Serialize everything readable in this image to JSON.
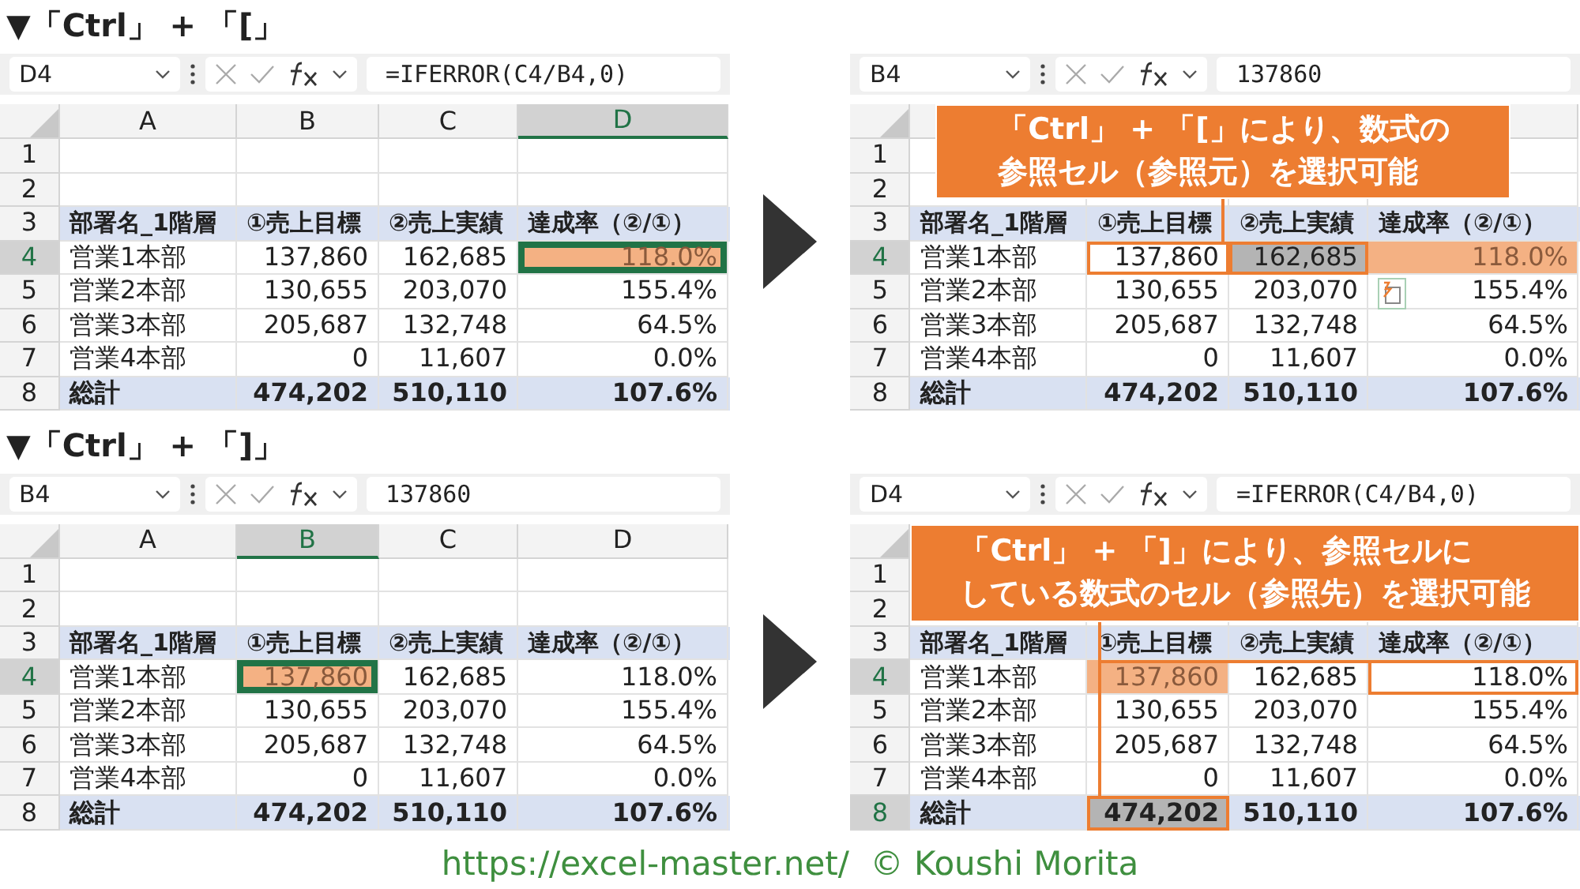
{
  "sheets": [
    {
      "title": "▼「Ctrl」 + 「[」",
      "name_box": "D4",
      "formula": "=IFERROR(C4/B4,0)",
      "column_headers": [
        {
          "label": "A",
          "selected": false
        },
        {
          "label": "B",
          "selected": false
        },
        {
          "label": "C",
          "selected": false
        },
        {
          "label": "D",
          "selected": true
        }
      ],
      "rows": [
        {
          "number": "1",
          "kind": "blank",
          "selected": false
        },
        {
          "number": "2",
          "kind": "blank",
          "selected": false
        },
        {
          "number": "3",
          "kind": "header",
          "selected": false,
          "cells": [
            {
              "text": "部署名_1階層",
              "highlighted": false,
              "shaded": false,
              "outlined": false,
              "active": false
            },
            {
              "text": "①売上目標",
              "highlighted": false,
              "shaded": false,
              "outlined": false,
              "active": false
            },
            {
              "text": "②売上実績",
              "highlighted": false,
              "shaded": false,
              "outlined": false,
              "active": false
            },
            {
              "text": "達成率（②/①）",
              "highlighted": false,
              "shaded": false,
              "outlined": false,
              "active": false
            }
          ]
        },
        {
          "number": "4",
          "kind": "data",
          "selected": true,
          "cells": [
            {
              "text": "営業1本部",
              "highlighted": false,
              "shaded": false,
              "outlined": false,
              "active": false
            },
            {
              "text": "137,860",
              "highlighted": false,
              "shaded": false,
              "outlined": false,
              "active": false
            },
            {
              "text": "162,685",
              "highlighted": false,
              "shaded": false,
              "outlined": false,
              "active": false
            },
            {
              "text": "118.0%",
              "highlighted": true,
              "shaded": false,
              "outlined": false,
              "active": true
            }
          ]
        },
        {
          "number": "5",
          "kind": "data",
          "selected": false,
          "cells": [
            {
              "text": "営業2本部",
              "highlighted": false,
              "shaded": false,
              "outlined": false,
              "active": false
            },
            {
              "text": "130,655",
              "highlighted": false,
              "shaded": false,
              "outlined": false,
              "active": false
            },
            {
              "text": "203,070",
              "highlighted": false,
              "shaded": false,
              "outlined": false,
              "active": false
            },
            {
              "text": "155.4%",
              "highlighted": false,
              "shaded": false,
              "outlined": false,
              "active": false
            }
          ]
        },
        {
          "number": "6",
          "kind": "data",
          "selected": false,
          "cells": [
            {
              "text": "営業3本部",
              "highlighted": false,
              "shaded": false,
              "outlined": false,
              "active": false
            },
            {
              "text": "205,687",
              "highlighted": false,
              "shaded": false,
              "outlined": false,
              "active": false
            },
            {
              "text": "132,748",
              "highlighted": false,
              "shaded": false,
              "outlined": false,
              "active": false
            },
            {
              "text": "64.5%",
              "highlighted": false,
              "shaded": false,
              "outlined": false,
              "active": false
            }
          ]
        },
        {
          "number": "7",
          "kind": "data",
          "selected": false,
          "cells": [
            {
              "text": "営業4本部",
              "highlighted": false,
              "shaded": false,
              "outlined": false,
              "active": false
            },
            {
              "text": "0",
              "highlighted": false,
              "shaded": false,
              "outlined": false,
              "active": false
            },
            {
              "text": "11,607",
              "highlighted": false,
              "shaded": false,
              "outlined": false,
              "active": false
            },
            {
              "text": "0.0%",
              "highlighted": false,
              "shaded": false,
              "outlined": false,
              "active": false
            }
          ]
        },
        {
          "number": "8",
          "kind": "total",
          "selected": false,
          "cells": [
            {
              "text": "総計",
              "highlighted": false,
              "shaded": false,
              "outlined": false,
              "active": false
            },
            {
              "text": "474,202",
              "highlighted": false,
              "shaded": false,
              "outlined": false,
              "active": false
            },
            {
              "text": "510,110",
              "highlighted": false,
              "shaded": false,
              "outlined": false,
              "active": false
            },
            {
              "text": "107.6%",
              "highlighted": false,
              "shaded": false,
              "outlined": false,
              "active": false
            }
          ]
        }
      ]
    },
    {
      "name_box": "B4",
      "formula": "137860",
      "callout": {
        "kind": "precedents",
        "lines": [
          "「Ctrl」 + 「[」により、数式の",
          "参照セル（参照元）を選択可能"
        ]
      },
      "rows": [
        {
          "number": "1",
          "kind": "blank",
          "selected": false
        },
        {
          "number": "2",
          "kind": "blank",
          "selected": false
        },
        {
          "number": "3",
          "kind": "header",
          "selected": false,
          "cells": [
            {
              "text": "部署名_1階層",
              "highlighted": false,
              "shaded": false,
              "outlined": false,
              "active": false
            },
            {
              "text": "①売上目標",
              "highlighted": false,
              "shaded": false,
              "outlined": false,
              "active": false
            },
            {
              "text": "②売上実績",
              "highlighted": false,
              "shaded": false,
              "outlined": false,
              "active": false
            },
            {
              "text": "達成率（②/①）",
              "highlighted": false,
              "shaded": false,
              "outlined": false,
              "active": false
            }
          ]
        },
        {
          "number": "4",
          "kind": "data",
          "selected": true,
          "cells": [
            {
              "text": "営業1本部",
              "highlighted": false,
              "shaded": false,
              "outlined": false,
              "active": false
            },
            {
              "text": "137,860",
              "highlighted": false,
              "shaded": false,
              "outlined": true,
              "active": false
            },
            {
              "text": "162,685",
              "highlighted": false,
              "shaded": true,
              "outlined": true,
              "active": false
            },
            {
              "text": "118.0%",
              "highlighted": true,
              "shaded": false,
              "outlined": false,
              "active": false
            }
          ]
        },
        {
          "number": "5",
          "kind": "data",
          "selected": false,
          "cells": [
            {
              "text": "営業2本部",
              "highlighted": false,
              "shaded": false,
              "outlined": false,
              "active": false
            },
            {
              "text": "130,655",
              "highlighted": false,
              "shaded": false,
              "outlined": false,
              "active": false
            },
            {
              "text": "203,070",
              "highlighted": false,
              "shaded": false,
              "outlined": false,
              "active": false
            },
            {
              "text": "155.4%",
              "highlighted": false,
              "shaded": false,
              "outlined": false,
              "active": false,
              "smart_tag": true
            }
          ]
        },
        {
          "number": "6",
          "kind": "data",
          "selected": false,
          "cells": [
            {
              "text": "営業3本部",
              "highlighted": false,
              "shaded": false,
              "outlined": false,
              "active": false
            },
            {
              "text": "205,687",
              "highlighted": false,
              "shaded": false,
              "outlined": false,
              "active": false
            },
            {
              "text": "132,748",
              "highlighted": false,
              "shaded": false,
              "outlined": false,
              "active": false
            },
            {
              "text": "64.5%",
              "highlighted": false,
              "shaded": false,
              "outlined": false,
              "active": false
            }
          ]
        },
        {
          "number": "7",
          "kind": "data",
          "selected": false,
          "cells": [
            {
              "text": "営業4本部",
              "highlighted": false,
              "shaded": false,
              "outlined": false,
              "active": false
            },
            {
              "text": "0",
              "highlighted": false,
              "shaded": false,
              "outlined": false,
              "active": false
            },
            {
              "text": "11,607",
              "highlighted": false,
              "shaded": false,
              "outlined": false,
              "active": false
            },
            {
              "text": "0.0%",
              "highlighted": false,
              "shaded": false,
              "outlined": false,
              "active": false
            }
          ]
        },
        {
          "number": "8",
          "kind": "total",
          "selected": false,
          "cells": [
            {
              "text": "総計",
              "highlighted": false,
              "shaded": false,
              "outlined": false,
              "active": false
            },
            {
              "text": "474,202",
              "highlighted": false,
              "shaded": false,
              "outlined": false,
              "active": false
            },
            {
              "text": "510,110",
              "highlighted": false,
              "shaded": false,
              "outlined": false,
              "active": false
            },
            {
              "text": "107.6%",
              "highlighted": false,
              "shaded": false,
              "outlined": false,
              "active": false
            }
          ]
        }
      ]
    },
    {
      "title": "▼「Ctrl」 + 「]」",
      "name_box": "B4",
      "formula": "137860",
      "column_headers": [
        {
          "label": "A",
          "selected": false
        },
        {
          "label": "B",
          "selected": true
        },
        {
          "label": "C",
          "selected": false
        },
        {
          "label": "D",
          "selected": false
        }
      ],
      "rows": [
        {
          "number": "1",
          "kind": "blank",
          "selected": false
        },
        {
          "number": "2",
          "kind": "blank",
          "selected": false
        },
        {
          "number": "3",
          "kind": "header",
          "selected": false,
          "cells": [
            {
              "text": "部署名_1階層",
              "highlighted": false,
              "shaded": false,
              "outlined": false,
              "active": false
            },
            {
              "text": "①売上目標",
              "highlighted": false,
              "shaded": false,
              "outlined": false,
              "active": false
            },
            {
              "text": "②売上実績",
              "highlighted": false,
              "shaded": false,
              "outlined": false,
              "active": false
            },
            {
              "text": "達成率（②/①）",
              "highlighted": false,
              "shaded": false,
              "outlined": false,
              "active": false
            }
          ]
        },
        {
          "number": "4",
          "kind": "data",
          "selected": true,
          "cells": [
            {
              "text": "営業1本部",
              "highlighted": false,
              "shaded": false,
              "outlined": false,
              "active": false
            },
            {
              "text": "137,860",
              "highlighted": true,
              "shaded": false,
              "outlined": false,
              "active": true
            },
            {
              "text": "162,685",
              "highlighted": false,
              "shaded": false,
              "outlined": false,
              "active": false
            },
            {
              "text": "118.0%",
              "highlighted": false,
              "shaded": false,
              "outlined": false,
              "active": false
            }
          ]
        },
        {
          "number": "5",
          "kind": "data",
          "selected": false,
          "cells": [
            {
              "text": "営業2本部",
              "highlighted": false,
              "shaded": false,
              "outlined": false,
              "active": false
            },
            {
              "text": "130,655",
              "highlighted": false,
              "shaded": false,
              "outlined": false,
              "active": false
            },
            {
              "text": "203,070",
              "highlighted": false,
              "shaded": false,
              "outlined": false,
              "active": false
            },
            {
              "text": "155.4%",
              "highlighted": false,
              "shaded": false,
              "outlined": false,
              "active": false
            }
          ]
        },
        {
          "number": "6",
          "kind": "data",
          "selected": false,
          "cells": [
            {
              "text": "営業3本部",
              "highlighted": false,
              "shaded": false,
              "outlined": false,
              "active": false
            },
            {
              "text": "205,687",
              "highlighted": false,
              "shaded": false,
              "outlined": false,
              "active": false
            },
            {
              "text": "132,748",
              "highlighted": false,
              "shaded": false,
              "outlined": false,
              "active": false
            },
            {
              "text": "64.5%",
              "highlighted": false,
              "shaded": false,
              "outlined": false,
              "active": false
            }
          ]
        },
        {
          "number": "7",
          "kind": "data",
          "selected": false,
          "cells": [
            {
              "text": "営業4本部",
              "highlighted": false,
              "shaded": false,
              "outlined": false,
              "active": false
            },
            {
              "text": "0",
              "highlighted": false,
              "shaded": false,
              "outlined": false,
              "active": false
            },
            {
              "text": "11,607",
              "highlighted": false,
              "shaded": false,
              "outlined": false,
              "active": false
            },
            {
              "text": "0.0%",
              "highlighted": false,
              "shaded": false,
              "outlined": false,
              "active": false
            }
          ]
        },
        {
          "number": "8",
          "kind": "total",
          "selected": false,
          "cells": [
            {
              "text": "総計",
              "highlighted": false,
              "shaded": false,
              "outlined": false,
              "active": false
            },
            {
              "text": "474,202",
              "highlighted": false,
              "shaded": false,
              "outlined": false,
              "active": false
            },
            {
              "text": "510,110",
              "highlighted": false,
              "shaded": false,
              "outlined": false,
              "active": false
            },
            {
              "text": "107.6%",
              "highlighted": false,
              "shaded": false,
              "outlined": false,
              "active": false
            }
          ]
        }
      ]
    },
    {
      "name_box": "D4",
      "formula": "=IFERROR(C4/B4,0)",
      "callout": {
        "kind": "dependents",
        "lines": [
          "「Ctrl」 + 「]」により、参照セルに",
          "している数式のセル（参照先）を選択可能"
        ]
      },
      "rows": [
        {
          "number": "1",
          "kind": "blank",
          "selected": false
        },
        {
          "number": "2",
          "kind": "blank",
          "selected": false
        },
        {
          "number": "3",
          "kind": "header",
          "selected": false,
          "cells": [
            {
              "text": "部署名_1階層",
              "highlighted": false,
              "shaded": false,
              "outlined": false,
              "active": false
            },
            {
              "text": "①売上目標",
              "highlighted": false,
              "shaded": false,
              "outlined": false,
              "active": false
            },
            {
              "text": "②売上実績",
              "highlighted": false,
              "shaded": false,
              "outlined": false,
              "active": false
            },
            {
              "text": "達成率（②/①）",
              "highlighted": false,
              "shaded": false,
              "outlined": false,
              "active": false
            }
          ]
        },
        {
          "number": "4",
          "kind": "data",
          "selected": true,
          "cells": [
            {
              "text": "営業1本部",
              "highlighted": false,
              "shaded": false,
              "outlined": false,
              "active": false
            },
            {
              "text": "137,860",
              "highlighted": true,
              "shaded": false,
              "outlined": false,
              "active": false
            },
            {
              "text": "162,685",
              "highlighted": false,
              "shaded": false,
              "outlined": false,
              "active": false
            },
            {
              "text": "118.0%",
              "highlighted": false,
              "shaded": false,
              "outlined": true,
              "active": false
            }
          ]
        },
        {
          "number": "5",
          "kind": "data",
          "selected": false,
          "cells": [
            {
              "text": "営業2本部",
              "highlighted": false,
              "shaded": false,
              "outlined": false,
              "active": false
            },
            {
              "text": "130,655",
              "highlighted": false,
              "shaded": false,
              "outlined": false,
              "active": false
            },
            {
              "text": "203,070",
              "highlighted": false,
              "shaded": false,
              "outlined": false,
              "active": false
            },
            {
              "text": "155.4%",
              "highlighted": false,
              "shaded": false,
              "outlined": false,
              "active": false
            }
          ]
        },
        {
          "number": "6",
          "kind": "data",
          "selected": false,
          "cells": [
            {
              "text": "営業3本部",
              "highlighted": false,
              "shaded": false,
              "outlined": false,
              "active": false
            },
            {
              "text": "205,687",
              "highlighted": false,
              "shaded": false,
              "outlined": false,
              "active": false
            },
            {
              "text": "132,748",
              "highlighted": false,
              "shaded": false,
              "outlined": false,
              "active": false
            },
            {
              "text": "64.5%",
              "highlighted": false,
              "shaded": false,
              "outlined": false,
              "active": false
            }
          ]
        },
        {
          "number": "7",
          "kind": "data",
          "selected": false,
          "cells": [
            {
              "text": "営業4本部",
              "highlighted": false,
              "shaded": false,
              "outlined": false,
              "active": false
            },
            {
              "text": "0",
              "highlighted": false,
              "shaded": false,
              "outlined": false,
              "active": false
            },
            {
              "text": "11,607",
              "highlighted": false,
              "shaded": false,
              "outlined": false,
              "active": false
            },
            {
              "text": "0.0%",
              "highlighted": false,
              "shaded": false,
              "outlined": false,
              "active": false
            }
          ]
        },
        {
          "number": "8",
          "kind": "total",
          "selected": true,
          "cells": [
            {
              "text": "総計",
              "highlighted": false,
              "shaded": false,
              "outlined": false,
              "active": false
            },
            {
              "text": "474,202",
              "highlighted": false,
              "shaded": true,
              "outlined": true,
              "active": false
            },
            {
              "text": "510,110",
              "highlighted": false,
              "shaded": false,
              "outlined": false,
              "active": false
            },
            {
              "text": "107.6%",
              "highlighted": false,
              "shaded": false,
              "outlined": false,
              "active": false
            }
          ]
        }
      ]
    }
  ],
  "footer": "https://excel-master.net/  © Koushi Morita"
}
